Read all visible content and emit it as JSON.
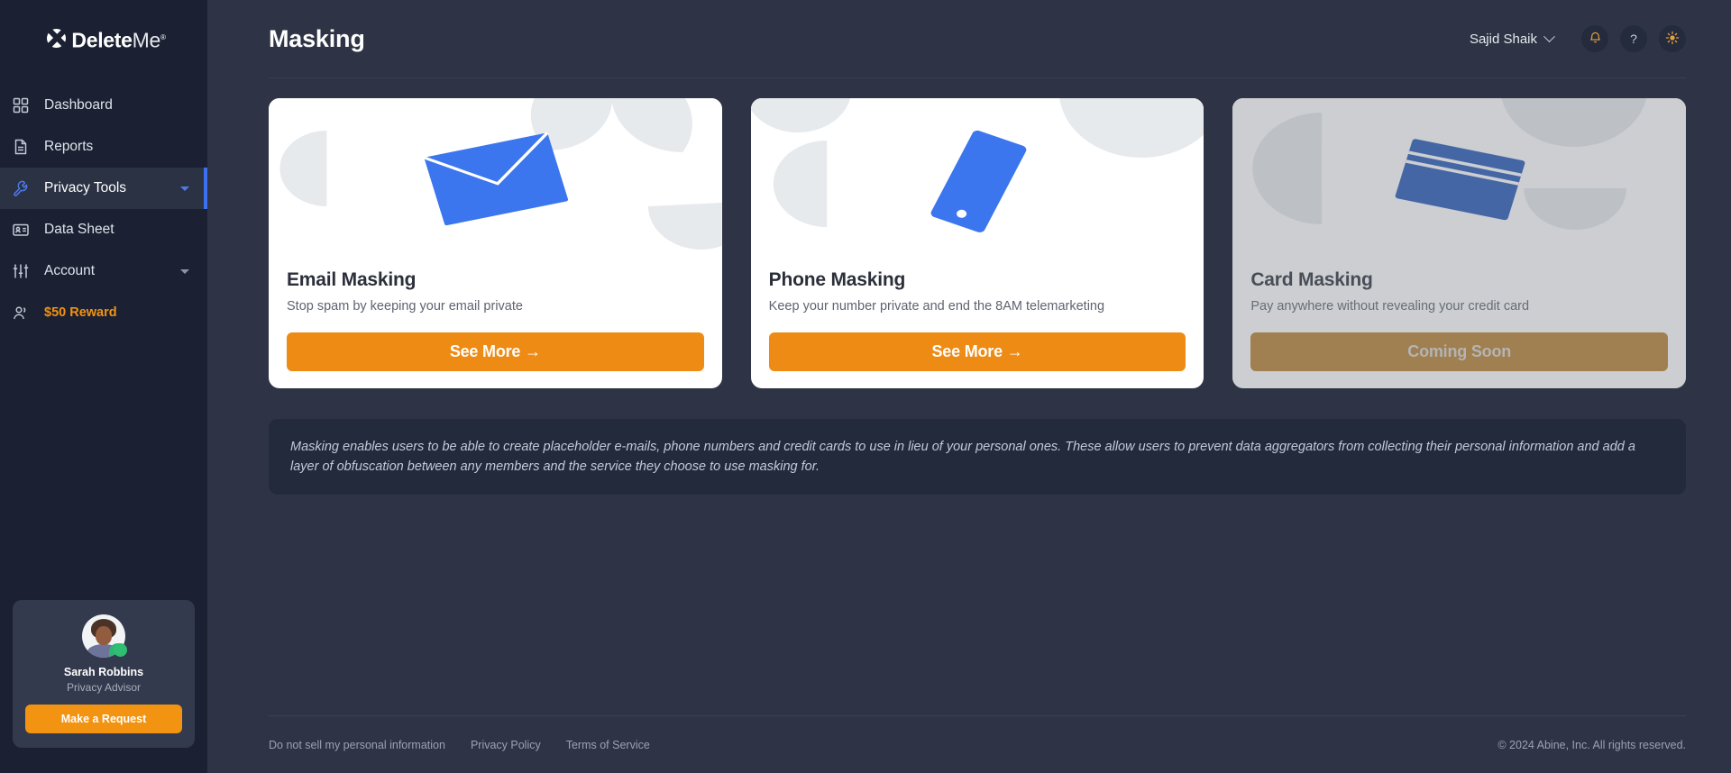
{
  "brand": {
    "name_bold": "Delete",
    "name_light": "Me",
    "registered": "®",
    "logo_icon": "deleteme-x-logo"
  },
  "sidebar": {
    "items": [
      {
        "label": "Dashboard",
        "icon": "grid-icon",
        "active": false,
        "caret": false
      },
      {
        "label": "Reports",
        "icon": "document-icon",
        "active": false,
        "caret": false
      },
      {
        "label": "Privacy Tools",
        "icon": "wrench-icon",
        "active": true,
        "caret": true
      },
      {
        "label": "Data Sheet",
        "icon": "id-card-icon",
        "active": false,
        "caret": false
      },
      {
        "label": "Account",
        "icon": "sliders-icon",
        "active": false,
        "caret": true
      },
      {
        "label": "$50 Reward",
        "icon": "people-icon",
        "active": false,
        "caret": false
      }
    ],
    "advisor": {
      "name": "Sarah Robbins",
      "role": "Privacy Advisor",
      "button_label": "Make a Request",
      "avatar_icon": "advisor-avatar",
      "status_icon": "online-status-dot"
    }
  },
  "header": {
    "title": "Masking",
    "user_name": "Sajid Shaik",
    "chevron_icon": "chevron-down-icon",
    "notification_icon": "bell-icon",
    "help_icon": "question-mark-icon",
    "theme_icon": "sun-icon",
    "help_glyph": "?"
  },
  "cards": [
    {
      "title": "Email Masking",
      "subtitle": "Stop spam by keeping your email private",
      "button_label": "See More →",
      "illustration": "envelope-illustration",
      "disabled": false
    },
    {
      "title": "Phone Masking",
      "subtitle": "Keep your number private and end the 8AM telemarketing",
      "button_label": "See More →",
      "illustration": "phone-illustration",
      "disabled": false
    },
    {
      "title": "Card Masking",
      "subtitle": "Pay anywhere without revealing your credit card",
      "button_label": "Coming Soon",
      "illustration": "credit-card-illustration",
      "disabled": true
    }
  ],
  "banner": {
    "text": "Masking enables users to be able to create placeholder e-mails, phone numbers and credit cards to use in lieu of your personal ones. These allow users to prevent data aggregators from collecting their personal information and add a layer of obfuscation between any members and the service they choose to use masking for."
  },
  "footer": {
    "links": [
      "Do not sell my personal information",
      "Privacy Policy",
      "Terms of Service"
    ],
    "copyright": "© 2024 Abine, Inc. All rights reserved."
  },
  "colors": {
    "accent_orange": "#ee8b14",
    "sidebar_bg": "#1b2133",
    "main_bg": "#2e3445",
    "active_blue": "#3b71f0",
    "illustration_blue": "#3b76ee",
    "shape_grey": "#e7eaed",
    "reward_orange": "#f29312"
  }
}
